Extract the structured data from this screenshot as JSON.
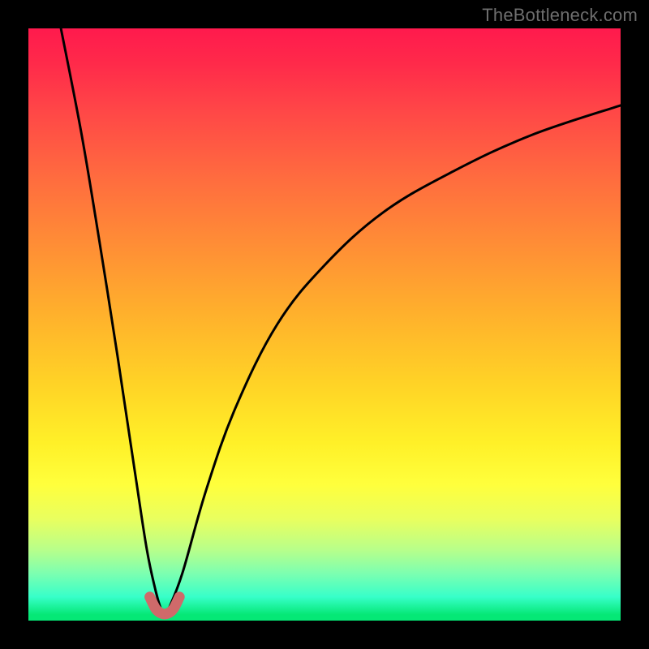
{
  "watermark": {
    "text": "TheBottleneck.com"
  },
  "chart_data": {
    "type": "line",
    "title": "",
    "xlabel": "",
    "ylabel": "",
    "xlim": [
      0,
      100
    ],
    "ylim": [
      0,
      100
    ],
    "grid": false,
    "legend": false,
    "notes": "V-shaped bottleneck curve over red-to-green vertical gradient; y decreases (better) toward bottom; minimum near x≈22.",
    "series": [
      {
        "name": "left-branch",
        "x": [
          5.5,
          9,
          12,
          15,
          18,
          20,
          21.5,
          22.5
        ],
        "y": [
          100,
          82,
          64,
          45,
          25,
          12,
          5,
          1.5
        ]
      },
      {
        "name": "valley-floor",
        "x": [
          20.5,
          21.5,
          22.5,
          23.5,
          24.5,
          25.5
        ],
        "y": [
          4,
          2,
          1.2,
          1.2,
          2,
          4
        ]
      },
      {
        "name": "right-branch",
        "x": [
          23.5,
          26,
          30,
          35,
          42,
          50,
          60,
          72,
          85,
          100
        ],
        "y": [
          1.5,
          8,
          22,
          36,
          50,
          60,
          69,
          76,
          82,
          87
        ]
      }
    ],
    "highlight": {
      "name": "valley-marker",
      "color": "#d46a6a",
      "thickness_px": 12,
      "x": [
        20.5,
        25.5
      ],
      "y_approx": [
        4,
        1.2,
        4
      ]
    },
    "background_gradient": {
      "direction": "top-to-bottom",
      "stops": [
        {
          "pos": 0.0,
          "color": "#ff1a4d"
        },
        {
          "pos": 0.25,
          "color": "#ff6b3f"
        },
        {
          "pos": 0.5,
          "color": "#ffb82a"
        },
        {
          "pos": 0.72,
          "color": "#fff028"
        },
        {
          "pos": 0.86,
          "color": "#c8ff7a"
        },
        {
          "pos": 1.0,
          "color": "#05e876"
        }
      ]
    }
  }
}
